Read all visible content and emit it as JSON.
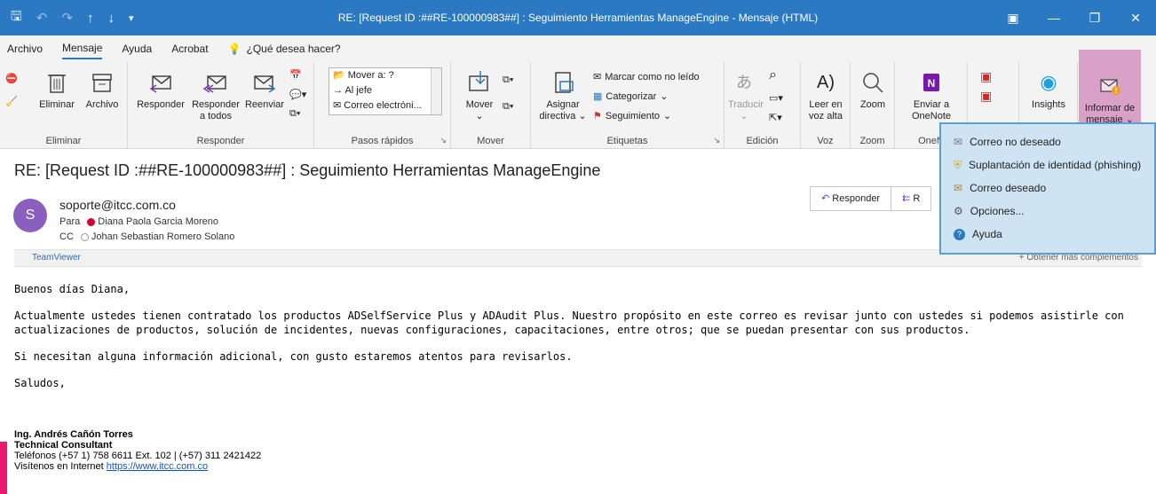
{
  "window": {
    "title": "RE: [Request ID :##RE-100000983##] : Seguimiento Herramientas ManageEngine  -  Mensaje (HTML)",
    "controls": [
      "▣",
      "—",
      "❐",
      "✕"
    ]
  },
  "tabs": [
    "Archivo",
    "Mensaje",
    "Ayuda",
    "Acrobat"
  ],
  "tell_me": "¿Qué desea hacer?",
  "ribbon": {
    "eliminar": {
      "btn1": "Eliminar",
      "btn2": "Archivo",
      "group": "Eliminar"
    },
    "responder": {
      "reply": "Responder",
      "reply_all_1": "Responder",
      "reply_all_2": "a todos",
      "forward": "Reenviar",
      "group": "Responder"
    },
    "quick_steps": {
      "items": [
        "Mover a: ?",
        "Al jefe",
        "Correo electróni..."
      ],
      "group": "Pasos rápidos"
    },
    "mover": {
      "btn": "Mover",
      "group": "Mover"
    },
    "etiquetas": {
      "assign_1": "Asignar",
      "assign_2": "directiva",
      "unread": "Marcar como no leído",
      "categorize": "Categorizar",
      "followup": "Seguimiento",
      "group": "Etiquetas"
    },
    "edicion": {
      "translate": "Traducir",
      "group": "Edición"
    },
    "voz": {
      "btn1": "Leer en",
      "btn2": "voz alta",
      "group": "Voz"
    },
    "zoom": {
      "btn": "Zoom",
      "group": "Zoom"
    },
    "onenote": {
      "btn1": "Enviar a",
      "btn2": "OneNote",
      "group": "OneN"
    },
    "insights": {
      "btn": "Insights"
    },
    "report": {
      "btn1": "Informar de",
      "btn2": "mensaje"
    }
  },
  "report_menu": {
    "items": [
      "Correo no deseado",
      "Suplantación de identidad (phishing)",
      "Correo deseado",
      "Opciones...",
      "Ayuda"
    ]
  },
  "message": {
    "subject": "RE: [Request ID :##RE-100000983##] : Seguimiento Herramientas ManageEngine",
    "avatar_letter": "S",
    "sender": "soporte@itcc.com.co",
    "to_label": "Para",
    "to_name": "Diana Paola Garcia Moreno",
    "cc_label": "CC",
    "cc_name": "Johan Sebastian Romero Solano",
    "reply_btn": "Responder",
    "reply_all_btn": "R",
    "addin": "TeamViewer",
    "more_addins": "+ Obtener más complementos"
  },
  "body": {
    "greeting": "Buenos días Diana,",
    "p1": "Actualmente ustedes tienen contratado los productos ADSelfService Plus y ADAudit Plus. Nuestro propósito en este correo es revisar junto con ustedes si podemos asistirle con actualizaciones de productos, solución de incidentes, nuevas configuraciones, capacitaciones, entre otros; que se puedan presentar con sus productos.",
    "p2": "Si necesitan alguna información adicional, con gusto estaremos atentos para revisarlos.",
    "closing": "Saludos,"
  },
  "signature": {
    "name": "Ing. Andrés Cañón Torres",
    "role": "Technical Consultant",
    "phones": "Teléfonos (+57 1) 758 6611 Ext. 102  |  (+57) 311 2421422",
    "web_label": "Visítenos en Internet ",
    "web_link": "https://www.itcc.com.co"
  }
}
